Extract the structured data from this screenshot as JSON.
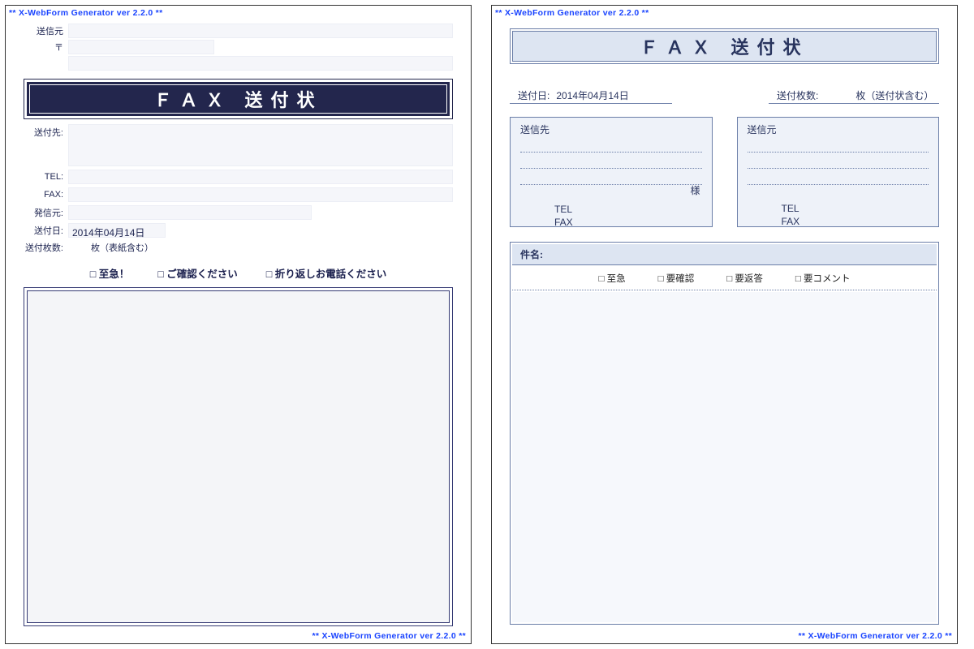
{
  "watermark": "** X-WebForm Generator ver 2.2.0 **",
  "templateA": {
    "sender_label": "送信元",
    "postal_label": "〒",
    "title": "ＦＡＸ 送付状",
    "to_label": "送付先:",
    "tel_label": "TEL:",
    "fax_label": "FAX:",
    "from_label": "発信元:",
    "senddate_label": "送付日:",
    "senddate_value": "2014年04月14日",
    "pages_label": "送付枚数:",
    "pages_suffix": "枚（表紙含む）",
    "check_urgent": "□ 至急！",
    "check_confirm": "□ ご確認ください",
    "check_callback": "□ 折り返しお電話ください"
  },
  "templateB": {
    "title": "ＦＡＸ 送付状",
    "senddate_label": "送付日:",
    "senddate_value": "2014年04月14日",
    "pages_label": "送付枚数:",
    "pages_suffix": "枚（送付状含む）",
    "to_title": "送信先",
    "from_title": "送信元",
    "sama": "様",
    "tel_label": "TEL",
    "fax_label": "FAX",
    "subject_label": "件名:",
    "check_urgent": "□ 至急",
    "check_confirm": "□ 要確認",
    "check_reply": "□ 要返答",
    "check_comment": "□ 要コメント"
  }
}
